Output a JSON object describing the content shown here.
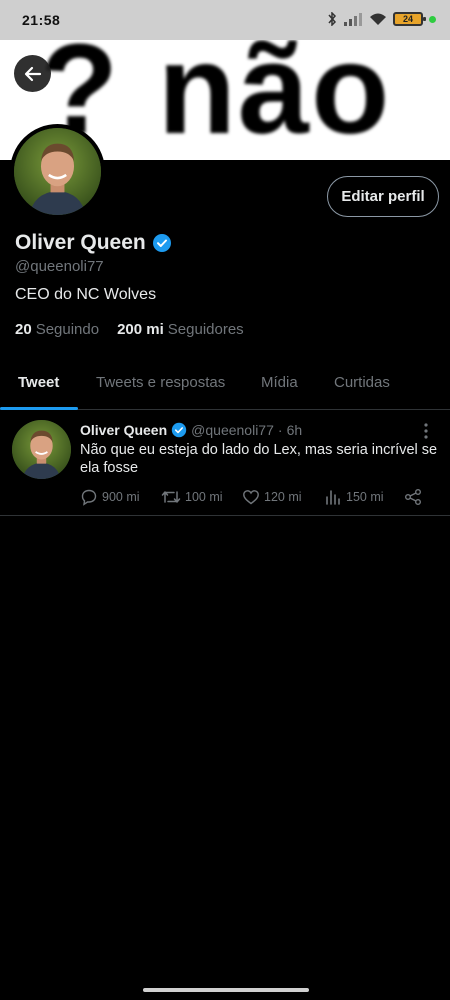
{
  "status_bar": {
    "time": "21:58",
    "battery": "24"
  },
  "banner": {
    "text": "? não"
  },
  "profile": {
    "edit_label": "Editar perfil",
    "name": "Oliver Queen",
    "handle": "@queenoli77",
    "bio": "CEO do NC Wolves",
    "following_count": "20",
    "following_label": "Seguindo",
    "followers_count": "200 mi",
    "followers_label": "Seguidores"
  },
  "tabs": [
    {
      "label": "Tweet",
      "active": true
    },
    {
      "label": "Tweets e respostas",
      "active": false
    },
    {
      "label": "Mídia",
      "active": false
    },
    {
      "label": "Curtidas",
      "active": false
    }
  ],
  "tweet": {
    "name": "Oliver Queen",
    "handle": "@queenoli77",
    "separator": "·",
    "time": "6h",
    "text": "Não que eu esteja do lado do Lex, mas seria incrível se ela fosse",
    "replies": "900 mi",
    "retweets": "100 mi",
    "likes": "120 mi",
    "views": "150 mi"
  },
  "colors": {
    "accent": "#1d9bf0",
    "muted": "#71767b",
    "background": "#000000"
  },
  "icons": [
    "back-arrow-icon",
    "verified-badge-icon",
    "reply-icon",
    "retweet-icon",
    "like-icon",
    "views-icon",
    "share-icon",
    "more-icon",
    "wifi-icon",
    "signal-icon",
    "battery-icon"
  ]
}
